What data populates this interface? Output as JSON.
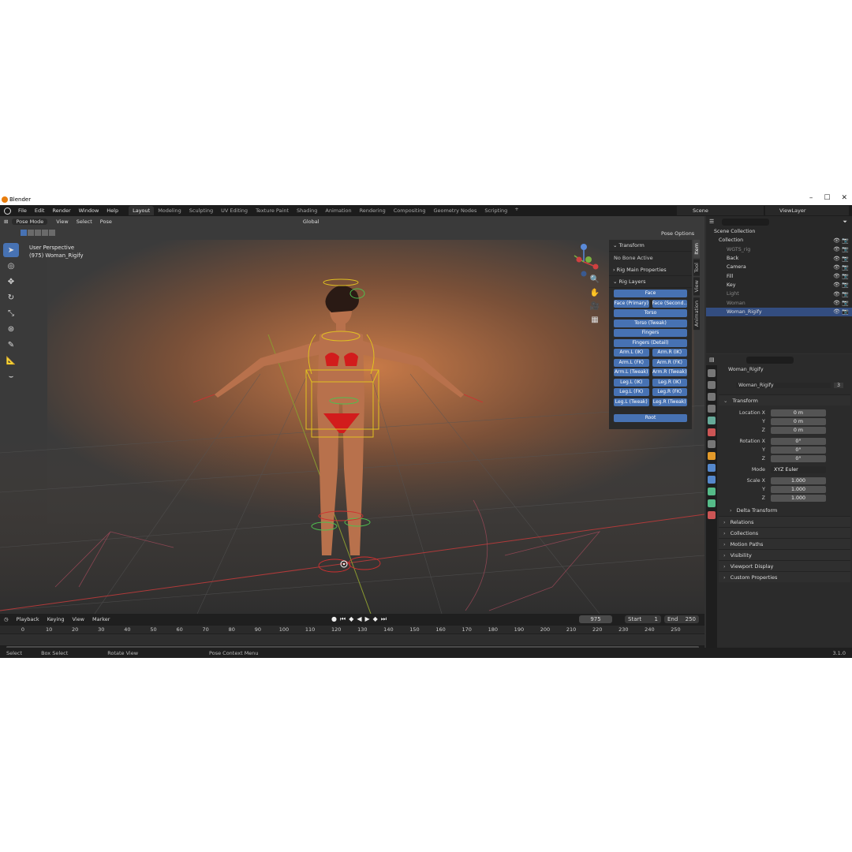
{
  "titlebar": {
    "title": "Blender",
    "minimize": "–",
    "maximize": "☐",
    "close": "✕"
  },
  "menu": [
    "File",
    "Edit",
    "Render",
    "Window",
    "Help"
  ],
  "workspaces": [
    {
      "label": "Layout",
      "active": true
    },
    {
      "label": "Modeling"
    },
    {
      "label": "Sculpting"
    },
    {
      "label": "UV Editing"
    },
    {
      "label": "Texture Paint"
    },
    {
      "label": "Shading"
    },
    {
      "label": "Animation"
    },
    {
      "label": "Rendering"
    },
    {
      "label": "Compositing"
    },
    {
      "label": "Geometry Nodes"
    },
    {
      "label": "Scripting"
    }
  ],
  "add_workspace": "+",
  "scene_name": "Scene",
  "view_layer": "ViewLayer",
  "viewport": {
    "mode": "Pose Mode",
    "menus": [
      "View",
      "Select",
      "Pose"
    ],
    "orientation": "Global",
    "perspective": "User Perspective",
    "object_info": "(975) Woman_Rigify",
    "pose_options": "Pose Options"
  },
  "npanel": {
    "transform_header": "Transform",
    "no_bone": "No Bone Active",
    "rig_main": "Rig Main Properties",
    "rig_layers": "Rig Layers",
    "layers_single": [
      "Face"
    ],
    "face_row": [
      "Face (Primary)",
      "Face (Second..."
    ],
    "layers_single2": [
      "Torso",
      "Torso (Tweak)",
      "Fingers",
      "Fingers (Detail)"
    ],
    "pairs": [
      [
        "Arm.L (IK)",
        "Arm.R (IK)"
      ],
      [
        "Arm.L (FK)",
        "Arm.R (FK)"
      ],
      [
        "Arm.L (Tweak)",
        "Arm.R (Tweak)"
      ],
      [
        "Leg.L (IK)",
        "Leg.R (IK)"
      ],
      [
        "Leg.L (FK)",
        "Leg.R (FK)"
      ],
      [
        "Leg.L (Tweak)",
        "Leg.R (Tweak)"
      ]
    ],
    "root": "Root",
    "tabs": [
      "Item",
      "Tool",
      "View",
      "Animation"
    ]
  },
  "timeline": {
    "menus": [
      "Playback",
      "Keying",
      "View",
      "Marker"
    ],
    "current_frame": "975",
    "start_label": "Start",
    "start": "1",
    "end_label": "End",
    "end": "250",
    "ticks": [
      "0",
      "10",
      "20",
      "30",
      "40",
      "50",
      "60",
      "70",
      "80",
      "90",
      "100",
      "110",
      "120",
      "130",
      "140",
      "150",
      "160",
      "170",
      "180",
      "190",
      "200",
      "210",
      "220",
      "230",
      "240",
      "250"
    ]
  },
  "status": {
    "select": "Select",
    "box_select": "Box Select",
    "rotate": "Rotate View",
    "context": "Pose Context Menu",
    "version": "3.1.0"
  },
  "outliner": {
    "scene_collection": "Scene Collection",
    "rows": [
      {
        "name": "Collection",
        "indent": 1
      },
      {
        "name": "WGTS_rig",
        "indent": 2,
        "dim": true
      },
      {
        "name": "Back",
        "indent": 2
      },
      {
        "name": "Camera",
        "indent": 2
      },
      {
        "name": "Fill",
        "indent": 2
      },
      {
        "name": "Key",
        "indent": 2
      },
      {
        "name": "Light",
        "indent": 2,
        "dim": true
      },
      {
        "name": "Woman",
        "indent": 2,
        "dim": true
      },
      {
        "name": "Woman_Rigify",
        "indent": 2,
        "selected": true
      }
    ]
  },
  "properties": {
    "object_name": "Woman_Rigify",
    "data_name": "Woman_Rigify",
    "users": "3",
    "transform": "Transform",
    "location": [
      {
        "label": "Location X",
        "val": "0 m"
      },
      {
        "label": "Y",
        "val": "0 m"
      },
      {
        "label": "Z",
        "val": "0 m"
      }
    ],
    "rotation": [
      {
        "label": "Rotation X",
        "val": "0°"
      },
      {
        "label": "Y",
        "val": "0°"
      },
      {
        "label": "Z",
        "val": "0°"
      }
    ],
    "mode_label": "Mode",
    "mode": "XYZ Euler",
    "scale": [
      {
        "label": "Scale X",
        "val": "1.000"
      },
      {
        "label": "Y",
        "val": "1.000"
      },
      {
        "label": "Z",
        "val": "1.000"
      }
    ],
    "delta": "Delta Transform",
    "sections": [
      "Relations",
      "Collections",
      "Motion Paths",
      "Visibility",
      "Viewport Display",
      "Custom Properties"
    ]
  },
  "colors": {
    "accent": "#4772b3",
    "bg": "#303030",
    "rig_yellow": "#e0c020",
    "rig_green": "#4fbf4f",
    "rig_red": "#d03030"
  }
}
